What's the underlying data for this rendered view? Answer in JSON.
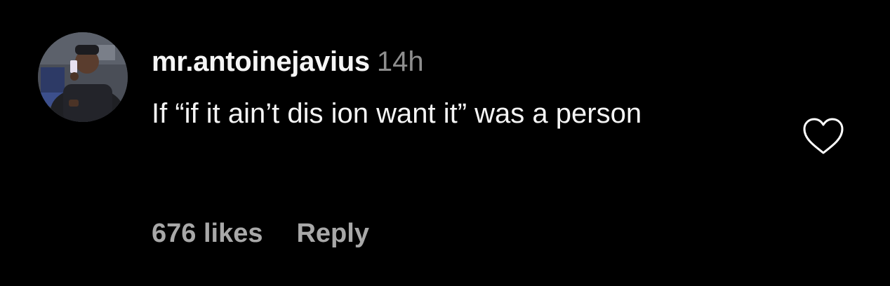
{
  "comment": {
    "username": "mr.antoinejavius",
    "timestamp": "14h",
    "text": "If “if it ain’t dis ion want it” was a person",
    "likes": "676 likes",
    "reply_label": "Reply",
    "like_icon": "heart-outline-icon"
  },
  "colors": {
    "background": "#000000",
    "primary_text": "#f5f5f5",
    "secondary_text": "#8e8e8e",
    "meta_text": "#a8a8a8"
  }
}
